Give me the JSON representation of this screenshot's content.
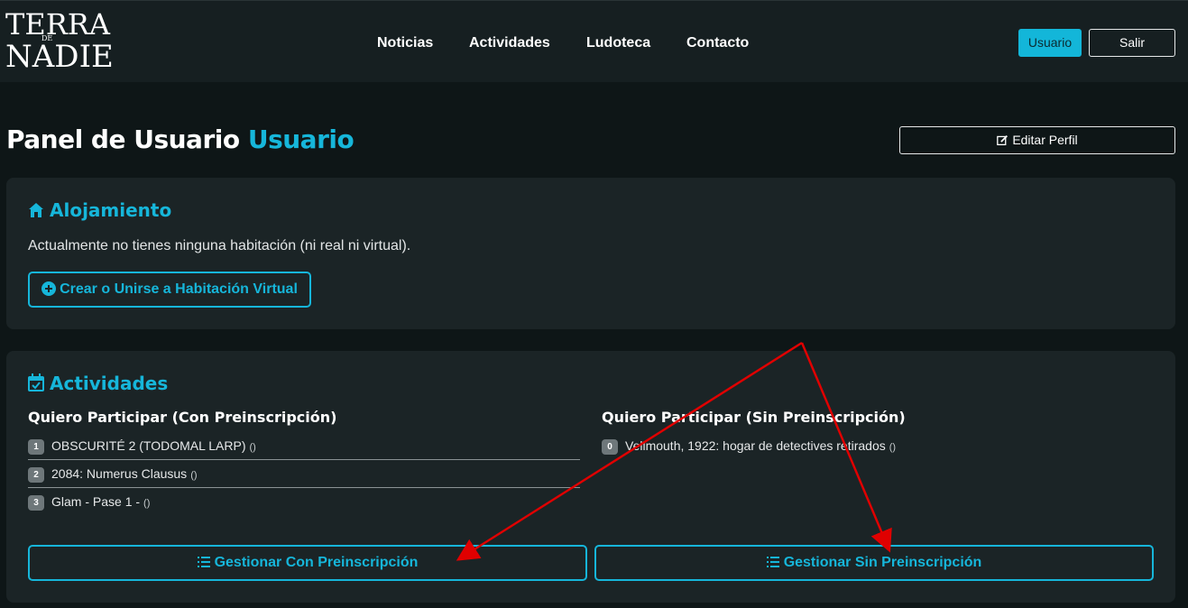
{
  "brand": {
    "line1": "TERRA",
    "line2": "DE",
    "line3": "NADIE"
  },
  "nav": {
    "links": [
      "Noticias",
      "Actividades",
      "Ludoteca",
      "Contacto"
    ],
    "user_button": "Usuario",
    "logout_button": "Salir"
  },
  "header": {
    "title_prefix": "Panel de Usuario",
    "title_user": "Usuario",
    "edit_profile": "Editar Perfil"
  },
  "alojamiento": {
    "title": "Alojamiento",
    "text": "Actualmente no tienes ninguna habitación (ni real ni virtual).",
    "create_button": "Crear o Unirse a Habitación Virtual"
  },
  "actividades": {
    "title": "Actividades",
    "with_prereg": {
      "title": "Quiero Participar (Con Preinscripción)",
      "items": [
        {
          "badge": "1",
          "name": "OBSCURITÉ 2 (TODOMAL LARP)",
          "meta": "()"
        },
        {
          "badge": "2",
          "name": "2084: Numerus Clausus",
          "meta": "()"
        },
        {
          "badge": "3",
          "name": "Glam - Pase 1 -",
          "meta": "()"
        }
      ],
      "manage_button": "Gestionar Con Preinscripción"
    },
    "without_prereg": {
      "title": "Quiero Participar (Sin Preinscripción)",
      "items": [
        {
          "badge": "0",
          "name": "Vellmouth, 1922: hogar de detectives retirados",
          "meta": "()"
        }
      ],
      "manage_button": "Gestionar Sin Preinscripción"
    }
  },
  "colors": {
    "accent": "#16b6da",
    "background": "#0e1617",
    "card": "#1b2426",
    "annotation_arrow": "#e00000"
  }
}
